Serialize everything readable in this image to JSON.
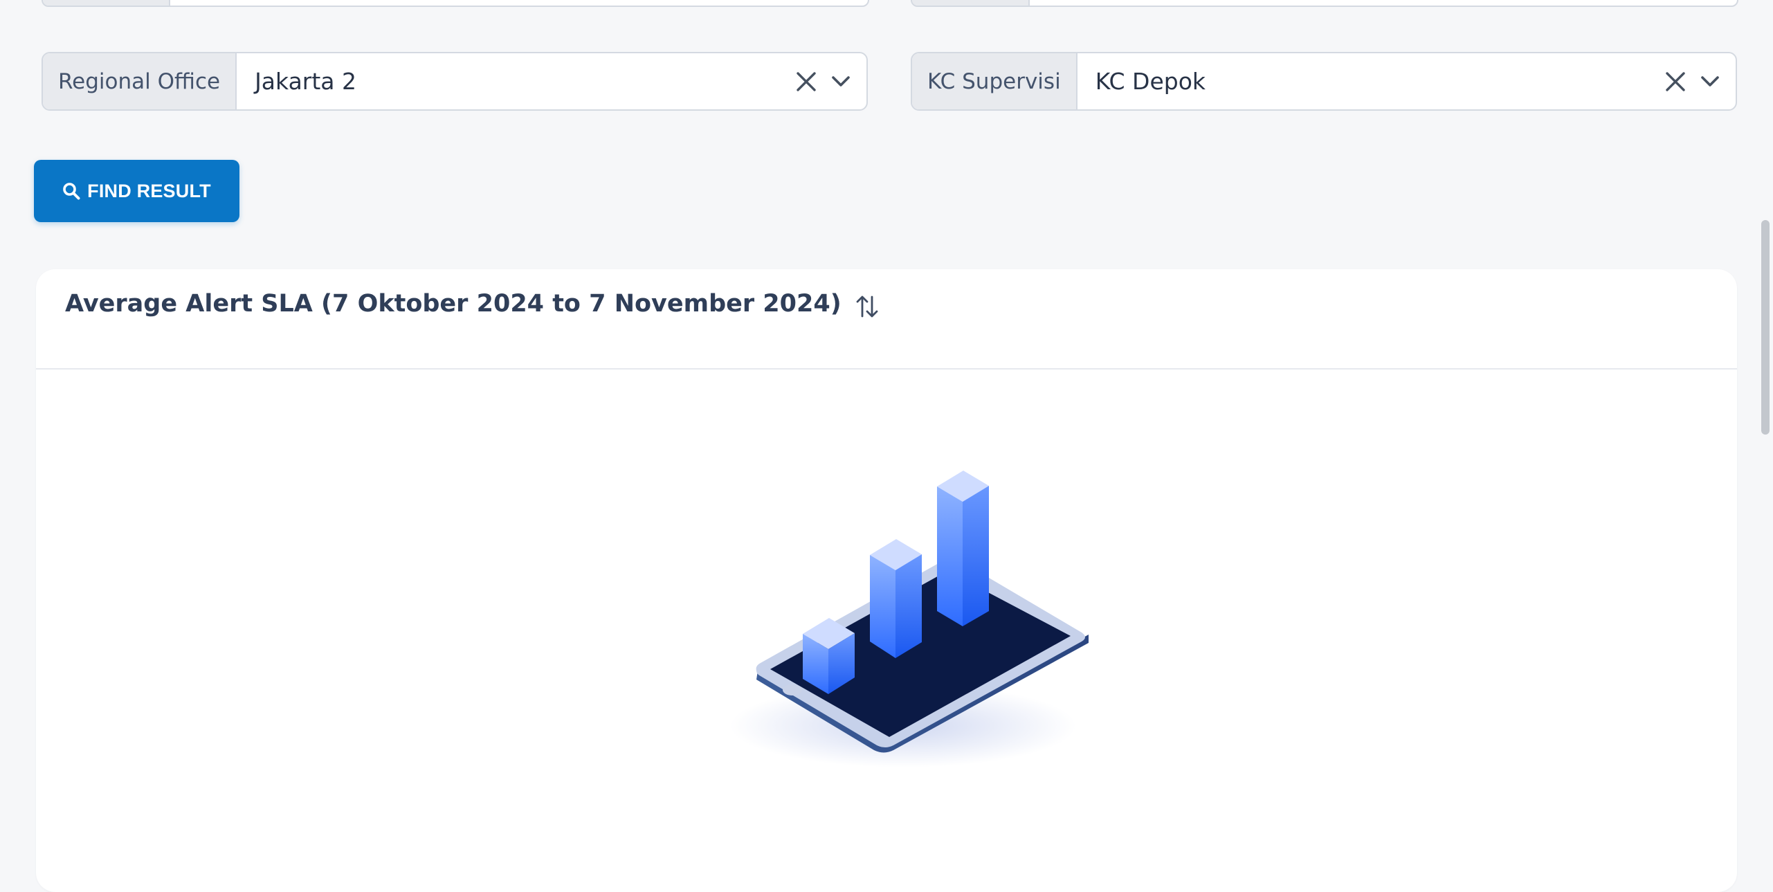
{
  "filters": {
    "regional_office": {
      "label": "Regional Office",
      "value": "Jakarta 2"
    },
    "kc_supervisi": {
      "label": "KC Supervisi",
      "value": "KC Depok"
    }
  },
  "actions": {
    "find_label": "FIND RESULT",
    "find_icon": "search-icon"
  },
  "card": {
    "title": "Average Alert SLA (7 Oktober 2024 to 7 November 2024)",
    "sort_icon": "sort-arrows-icon",
    "empty_state_illustration": "phone-bar-chart-illustration"
  },
  "colors": {
    "primary_button": "#0a76c6",
    "page_background": "#f6f7f9",
    "card_background": "#ffffff",
    "addon_background": "#e8eaee",
    "title_text": "#2f3e58"
  }
}
